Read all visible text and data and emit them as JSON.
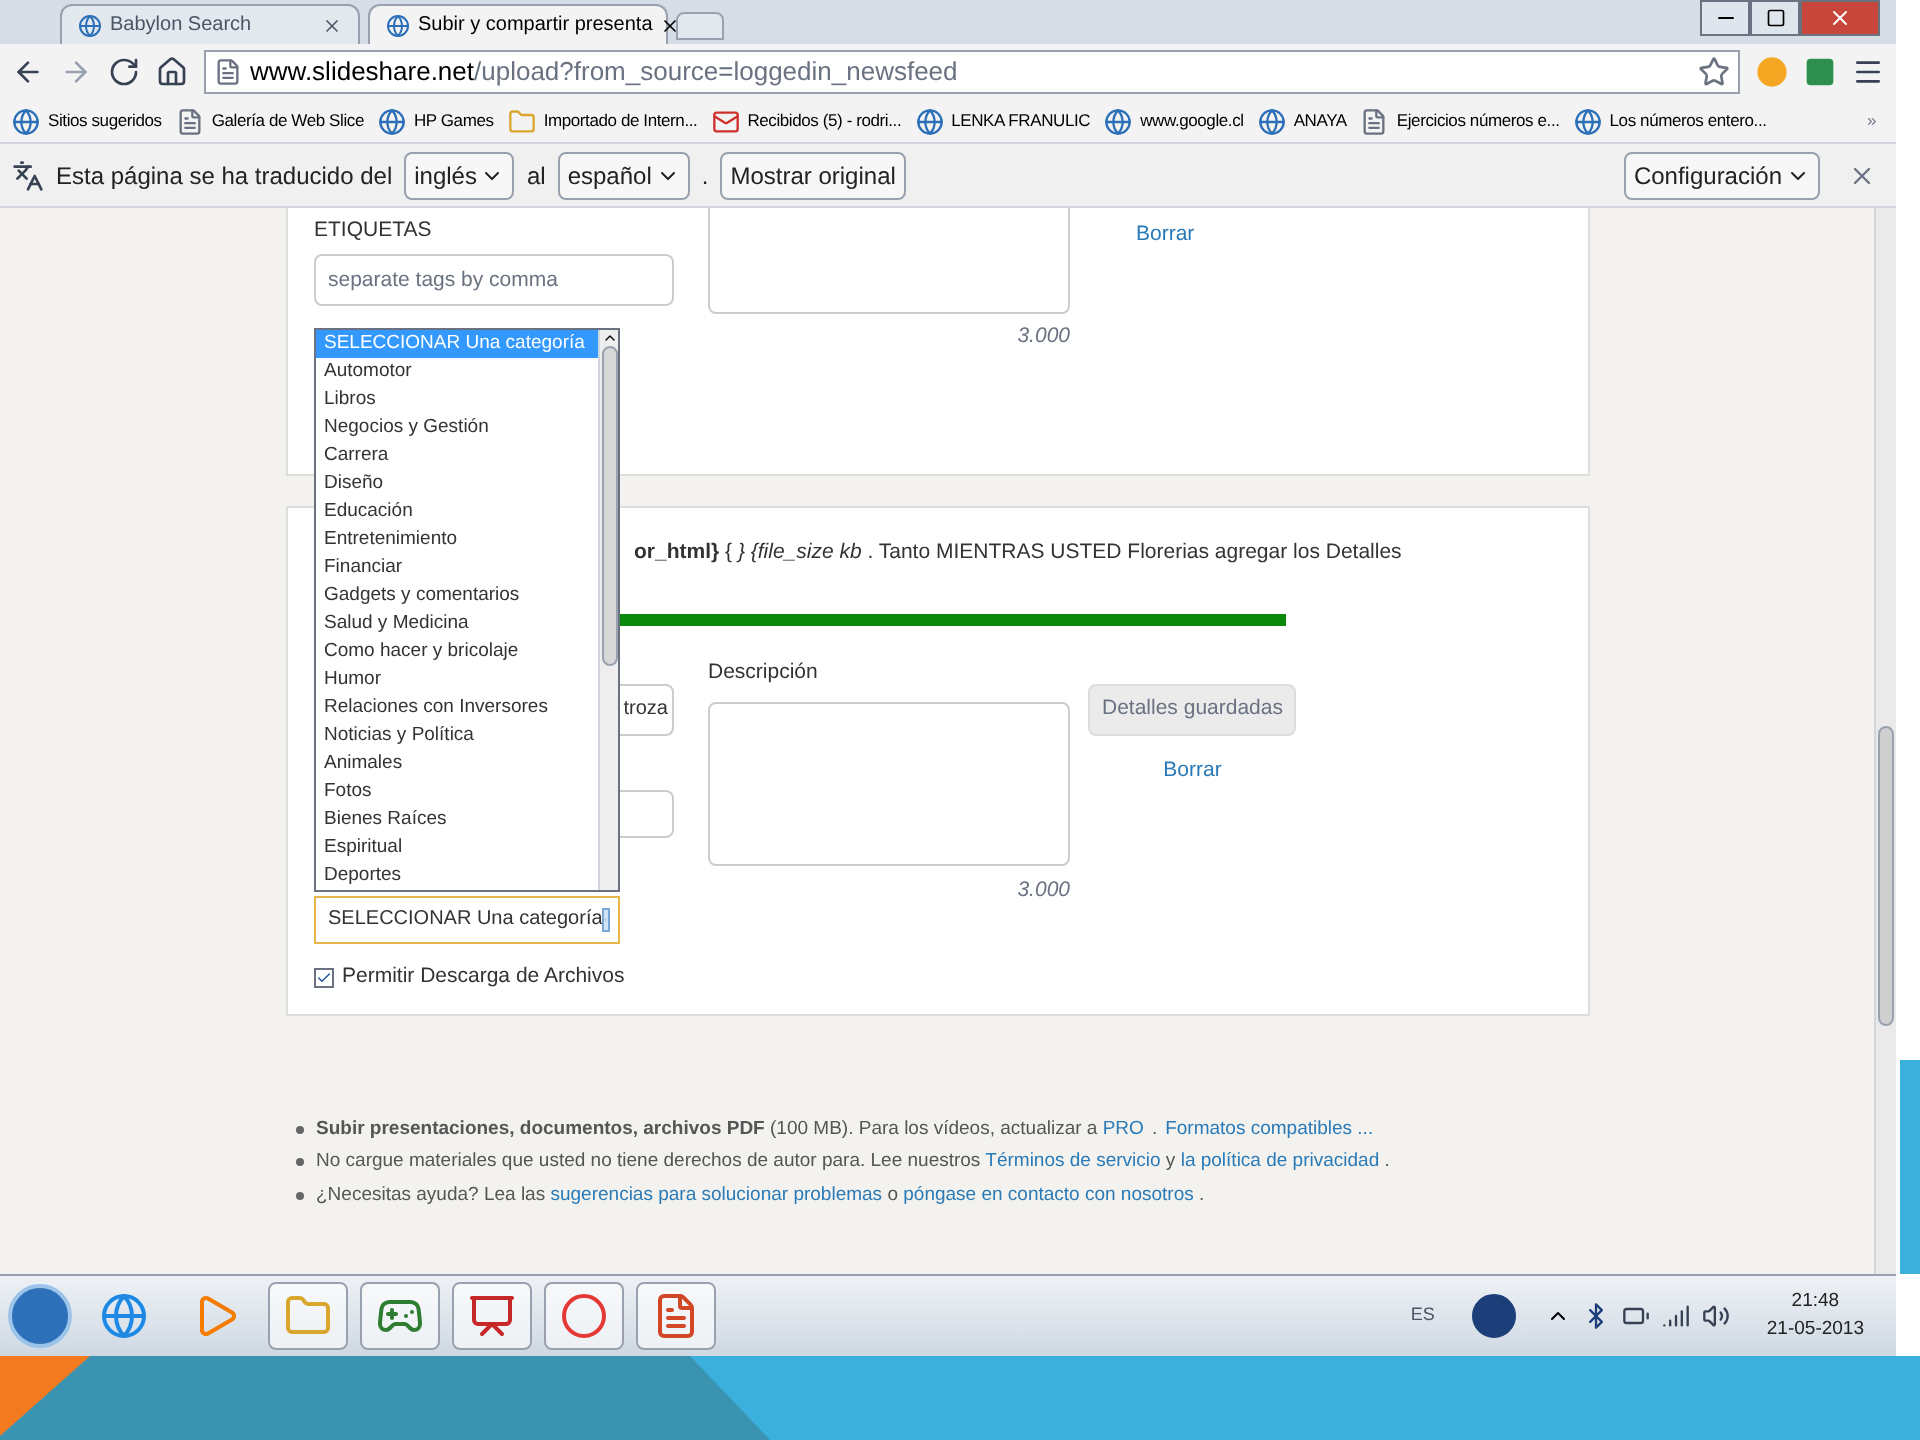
{
  "browser": {
    "tabs": [
      {
        "title": "Babylon Search",
        "selected": false
      },
      {
        "title": "Subir y compartir presenta",
        "selected": true
      }
    ],
    "address": {
      "host": "www.slideshare.net",
      "path": "/upload?from_source=loggedin_newsfeed"
    },
    "bookmarks": [
      {
        "label": "Sitios sugeridos",
        "kind": "site"
      },
      {
        "label": "Galería de Web Slice",
        "kind": "page"
      },
      {
        "label": "HP Games",
        "kind": "site"
      },
      {
        "label": "Importado de Intern...",
        "kind": "folder"
      },
      {
        "label": "Recibidos (5) - rodri...",
        "kind": "mail"
      },
      {
        "label": "LENKA FRANULIC",
        "kind": "site"
      },
      {
        "label": "www.google.cl",
        "kind": "site"
      },
      {
        "label": "ANAYA",
        "kind": "site"
      },
      {
        "label": "Ejercicios números e...",
        "kind": "page"
      },
      {
        "label": "Los números entero...",
        "kind": "site"
      }
    ],
    "more_bookmarks": "»",
    "translate_bar": {
      "prefix": "Esta página se ha traducido del",
      "from": "inglés",
      "middle": "al",
      "to": "español",
      "dot": ".",
      "show_original": "Mostrar original",
      "settings": "Configuración"
    }
  },
  "page": {
    "card1": {
      "tags_label": "ETIQUETAS",
      "tags_placeholder": "separate tags by comma",
      "counter": "3.000",
      "delete_link": "Borrar"
    },
    "card2": {
      "status": "**or_html}** { *} {file_size kb* . Tanto MIENTRAS USTED Florerias agregar los Detalles",
      "progress": {
        "level": 1
      },
      "title_value": "troza",
      "description_label": "Descripción",
      "counter": "3.000",
      "save_button": {
        "label": "Detalles guardadas",
        "disabled": true
      },
      "delete_link": "Borrar",
      "category_select": {
        "value": "SELECCIONAR Una categoría",
        "expanded": true,
        "options": [
          {
            "label": "SELECCIONAR Una categoría",
            "selected": true
          },
          {
            "label": "Automotor",
            "selected": false
          },
          {
            "label": "Libros",
            "selected": false
          },
          {
            "label": "Negocios y Gestión",
            "selected": false
          },
          {
            "label": "Carrera",
            "selected": false
          },
          {
            "label": "Diseño",
            "selected": false
          },
          {
            "label": "Educación",
            "selected": false
          },
          {
            "label": "Entretenimiento",
            "selected": false
          },
          {
            "label": "Financiar",
            "selected": false
          },
          {
            "label": "Gadgets y comentarios",
            "selected": false
          },
          {
            "label": "Salud y Medicina",
            "selected": false
          },
          {
            "label": "Como hacer y bricolaje",
            "selected": false
          },
          {
            "label": "Humor",
            "selected": false
          },
          {
            "label": "Relaciones con Inversores",
            "selected": false
          },
          {
            "label": "Noticias y Política",
            "selected": false
          },
          {
            "label": "Animales",
            "selected": false
          },
          {
            "label": "Fotos",
            "selected": false
          },
          {
            "label": "Bienes Raíces",
            "selected": false
          },
          {
            "label": "Espiritual",
            "selected": false
          },
          {
            "label": "Deportes",
            "selected": false
          }
        ]
      },
      "download": {
        "label": "Permitir Descarga de Archivos",
        "checked": true
      }
    },
    "notes": [
      [
        {
          "text": "Subir presentaciones, documentos, archivos PDF",
          "kind": "bold"
        },
        {
          "text": " (100 MB). Para los vídeos, actualizar a ",
          "kind": "plain"
        },
        {
          "text": "PRO",
          "kind": "link"
        },
        {
          "text": ".",
          "kind": "dot"
        },
        {
          "text": "Formatos compatibles ...",
          "kind": "link"
        }
      ],
      [
        {
          "text": "No cargue materiales que usted no tiene derechos de autor para. Lee nuestros ",
          "kind": "plain"
        },
        {
          "text": "Términos de servicio",
          "kind": "link"
        },
        {
          "text": " y ",
          "kind": "plain"
        },
        {
          "text": "la política de privacidad",
          "kind": "link"
        },
        {
          "text": " .",
          "kind": "plain"
        }
      ],
      [
        {
          "text": "¿Necesitas ayuda? Lea las ",
          "kind": "plain"
        },
        {
          "text": "sugerencias para solucionar problemas",
          "kind": "link"
        },
        {
          "text": " o ",
          "kind": "plain"
        },
        {
          "text": "póngase en contacto con nosotros",
          "kind": "link"
        },
        {
          "text": " .",
          "kind": "plain"
        }
      ]
    ]
  },
  "taskbar": {
    "apps": [
      {
        "kind": "browser",
        "open": false
      },
      {
        "kind": "media",
        "open": false
      },
      {
        "kind": "folder",
        "open": true
      },
      {
        "kind": "games",
        "open": true
      },
      {
        "kind": "slides",
        "open": true
      },
      {
        "kind": "chrome",
        "open": true
      },
      {
        "kind": "powerpoint",
        "open": true
      }
    ],
    "language": "ES",
    "time": "21:48",
    "date": "21-05-2013"
  }
}
